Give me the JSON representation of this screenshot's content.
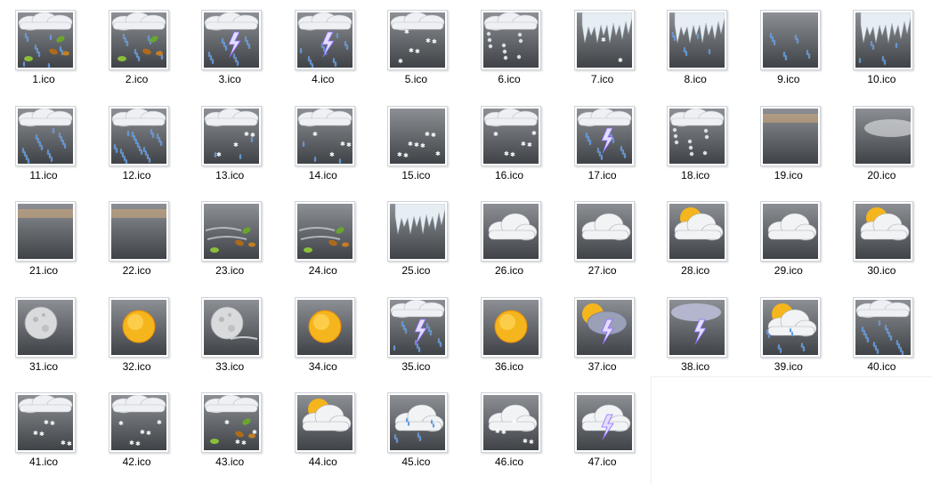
{
  "files": [
    {
      "name": "1.ico",
      "icon": "wind-rain-leaves-icon"
    },
    {
      "name": "2.ico",
      "icon": "wind-rain-leaves-icon"
    },
    {
      "name": "3.ico",
      "icon": "thunderstorm-rain-icon"
    },
    {
      "name": "4.ico",
      "icon": "thunderstorm-rain-icon"
    },
    {
      "name": "5.ico",
      "icon": "snow-cloud-icon"
    },
    {
      "name": "6.ico",
      "icon": "hail-cloud-icon"
    },
    {
      "name": "7.ico",
      "icon": "icicles-snow-icon"
    },
    {
      "name": "8.ico",
      "icon": "icicles-rain-icon"
    },
    {
      "name": "9.ico",
      "icon": "drizzle-icon"
    },
    {
      "name": "10.ico",
      "icon": "icicles-rain-icon"
    },
    {
      "name": "11.ico",
      "icon": "rain-cloud-icon"
    },
    {
      "name": "12.ico",
      "icon": "heavy-rain-cloud-icon"
    },
    {
      "name": "13.ico",
      "icon": "sleet-cloud-icon"
    },
    {
      "name": "14.ico",
      "icon": "sleet-cloud-icon"
    },
    {
      "name": "15.ico",
      "icon": "flurries-icon"
    },
    {
      "name": "16.ico",
      "icon": "snow-cloud-icon"
    },
    {
      "name": "17.ico",
      "icon": "thunderstorm-rain-icon"
    },
    {
      "name": "18.ico",
      "icon": "hail-cloud-icon"
    },
    {
      "name": "19.ico",
      "icon": "haze-icon"
    },
    {
      "name": "20.ico",
      "icon": "fog-icon"
    },
    {
      "name": "21.ico",
      "icon": "haze-icon"
    },
    {
      "name": "22.ico",
      "icon": "haze-icon"
    },
    {
      "name": "23.ico",
      "icon": "wind-leaves-icon"
    },
    {
      "name": "24.ico",
      "icon": "wind-leaves-icon"
    },
    {
      "name": "25.ico",
      "icon": "icicles-icon"
    },
    {
      "name": "26.ico",
      "icon": "cloudy-icon"
    },
    {
      "name": "27.ico",
      "icon": "cloudy-night-icon"
    },
    {
      "name": "28.ico",
      "icon": "partly-cloudy-day-icon"
    },
    {
      "name": "29.ico",
      "icon": "cloudy-night-icon"
    },
    {
      "name": "30.ico",
      "icon": "partly-cloudy-day-icon"
    },
    {
      "name": "31.ico",
      "icon": "moon-icon"
    },
    {
      "name": "32.ico",
      "icon": "sun-icon"
    },
    {
      "name": "33.ico",
      "icon": "moon-clouds-icon"
    },
    {
      "name": "34.ico",
      "icon": "sun-icon"
    },
    {
      "name": "35.ico",
      "icon": "thunderstorm-rain-icon"
    },
    {
      "name": "36.ico",
      "icon": "sun-icon"
    },
    {
      "name": "37.ico",
      "icon": "sun-thunderstorm-icon"
    },
    {
      "name": "38.ico",
      "icon": "lightning-icon"
    },
    {
      "name": "39.ico",
      "icon": "sun-rain-icon"
    },
    {
      "name": "40.ico",
      "icon": "rain-cloud-icon"
    },
    {
      "name": "41.ico",
      "icon": "snow-cloud-icon"
    },
    {
      "name": "42.ico",
      "icon": "snow-cloud-icon"
    },
    {
      "name": "43.ico",
      "icon": "wind-snow-leaves-icon"
    },
    {
      "name": "44.ico",
      "icon": "partly-cloudy-day-icon"
    },
    {
      "name": "45.ico",
      "icon": "rain-night-icon"
    },
    {
      "name": "46.ico",
      "icon": "snow-night-icon"
    },
    {
      "name": "47.ico",
      "icon": "thunderstorm-night-icon"
    }
  ]
}
